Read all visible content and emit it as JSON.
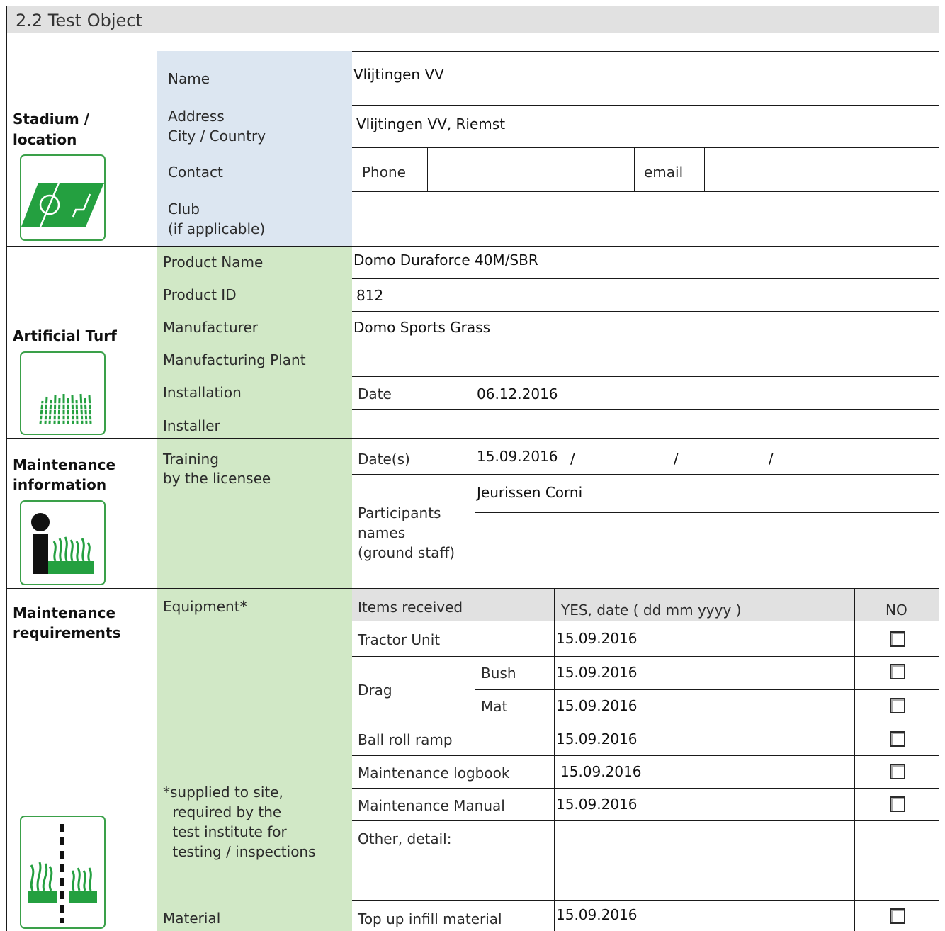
{
  "section_title": "2.2 Test Object",
  "stadium": {
    "heading_line1": "Stadium /",
    "heading_line2": "location",
    "icon": "football-pitch-icon",
    "name_label": "Name",
    "name_value": "Vlijtingen VV",
    "address_label_line1": "Address",
    "address_label_line2": "City / Country",
    "address_value": "Vlijtingen VV, Riemst",
    "contact_label": "Contact",
    "phone_label": "Phone",
    "phone_value": "",
    "email_label": "email",
    "email_value": "",
    "club_label_line1": "Club",
    "club_label_line2": "(if applicable)",
    "club_value": ""
  },
  "turf": {
    "heading": "Artificial Turf",
    "icon": "grass-turf-icon",
    "product_name_label": "Product Name",
    "product_name_value": "Domo Duraforce 40M/SBR",
    "product_id_label": "Product ID",
    "product_id_value": "812",
    "manufacturer_label": "Manufacturer",
    "manufacturer_value": "Domo Sports Grass",
    "plant_label": "Manufacturing Plant",
    "plant_value": "",
    "installation_label": "Installation",
    "date_label": "Date",
    "date_value": "06.12.2016",
    "installer_label": "Installer",
    "installer_value": ""
  },
  "maint_info": {
    "heading_line1": "Maintenance",
    "heading_line2": "information",
    "icon": "info-grass-icon",
    "training_line1": "Training",
    "training_line2": "by the licensee",
    "dates_label": "Date(s)",
    "date1": "15.09.2016",
    "sep1": "/",
    "sep2": "/",
    "sep3": "/",
    "participants_line1": "Participants",
    "participants_line2": "names",
    "participants_line3": "(ground staff)",
    "participants": [
      "Jeurissen Corni",
      "",
      ""
    ]
  },
  "maint_req": {
    "heading_line1": "Maintenance",
    "heading_line2": "requirements",
    "icon": "grass-comparison-icon",
    "equipment_label": "Equipment*",
    "footnote": [
      "*supplied to site,",
      " required by the",
      " test institute for",
      " testing / inspections"
    ],
    "col_items": "Items received",
    "col_yes": "YES, date ( dd mm yyyy )",
    "col_no": "NO",
    "tractor_label": "Tractor Unit",
    "tractor_date": "15.09.2016",
    "drag_label": "Drag",
    "bush_label": "Bush",
    "bush_date": "15.09.2016",
    "mat_label": "Mat",
    "mat_date": "15.09.2016",
    "ramp_label": "Ball roll ramp",
    "ramp_date": "15.09.2016",
    "logbook_label": "Maintenance logbook",
    "logbook_date": "15.09.2016",
    "manual_label": "Maintenance Manual",
    "manual_date": "15.09.2016",
    "other_label": "Other, detail:",
    "material_label": "Material",
    "infill_label": "Top up infill material",
    "infill_date": "15.09.2016"
  }
}
